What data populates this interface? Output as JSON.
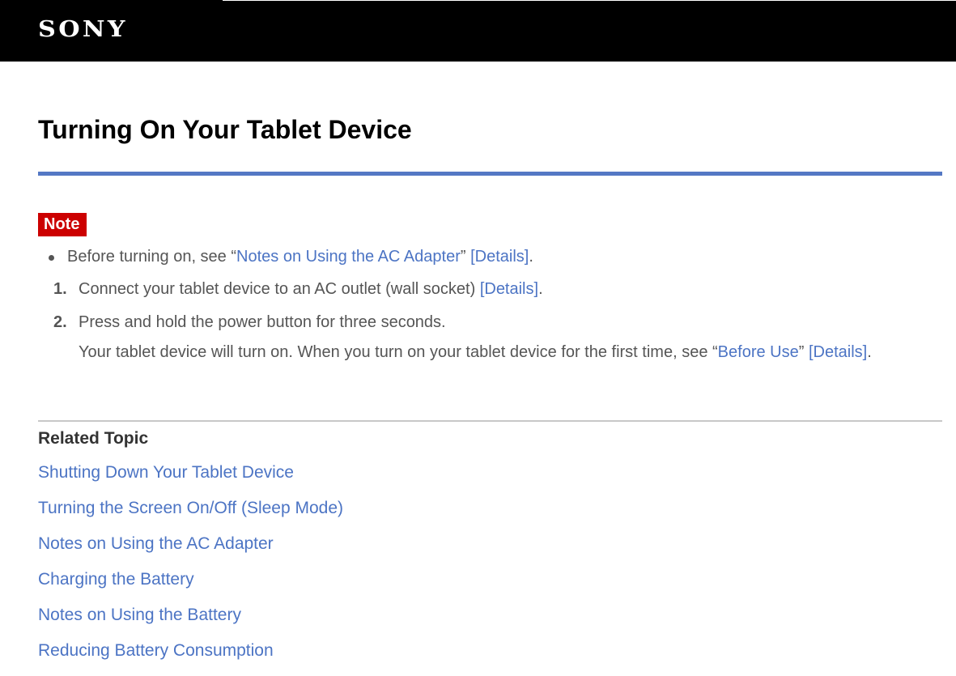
{
  "header": {
    "brand": "SONY"
  },
  "page": {
    "title": "Turning On Your Tablet Device"
  },
  "note": {
    "badge": "Note",
    "bullet": {
      "prefix": "Before turning on, see “",
      "link": "Notes on Using the AC Adapter",
      "mid": "” ",
      "details_link": "[Details]",
      "suffix": "."
    }
  },
  "steps": [
    {
      "number": "1.",
      "text": "Connect your tablet device to an AC outlet (wall socket) ",
      "details_link": "[Details]",
      "suffix": "."
    },
    {
      "number": "2.",
      "text": "Press and hold the power button for three seconds.",
      "detail_prefix": "Your tablet device will turn on. When you turn on your tablet device for the first time, see “",
      "detail_link": "Before Use",
      "detail_mid": "” ",
      "details_link": "[Details]",
      "detail_suffix": "."
    }
  ],
  "related": {
    "heading": "Related Topic",
    "items": [
      "Shutting Down Your Tablet Device",
      "Turning the Screen On/Off (Sleep Mode)",
      "Notes on Using the AC Adapter",
      "Charging the Battery",
      "Notes on Using the Battery",
      "Reducing Battery Consumption"
    ]
  },
  "colors": {
    "header_bg": "#000000",
    "accent_rule": "#5478c4",
    "link": "#4c74c4",
    "note_badge": "#cc0000",
    "body_text": "#555555"
  }
}
